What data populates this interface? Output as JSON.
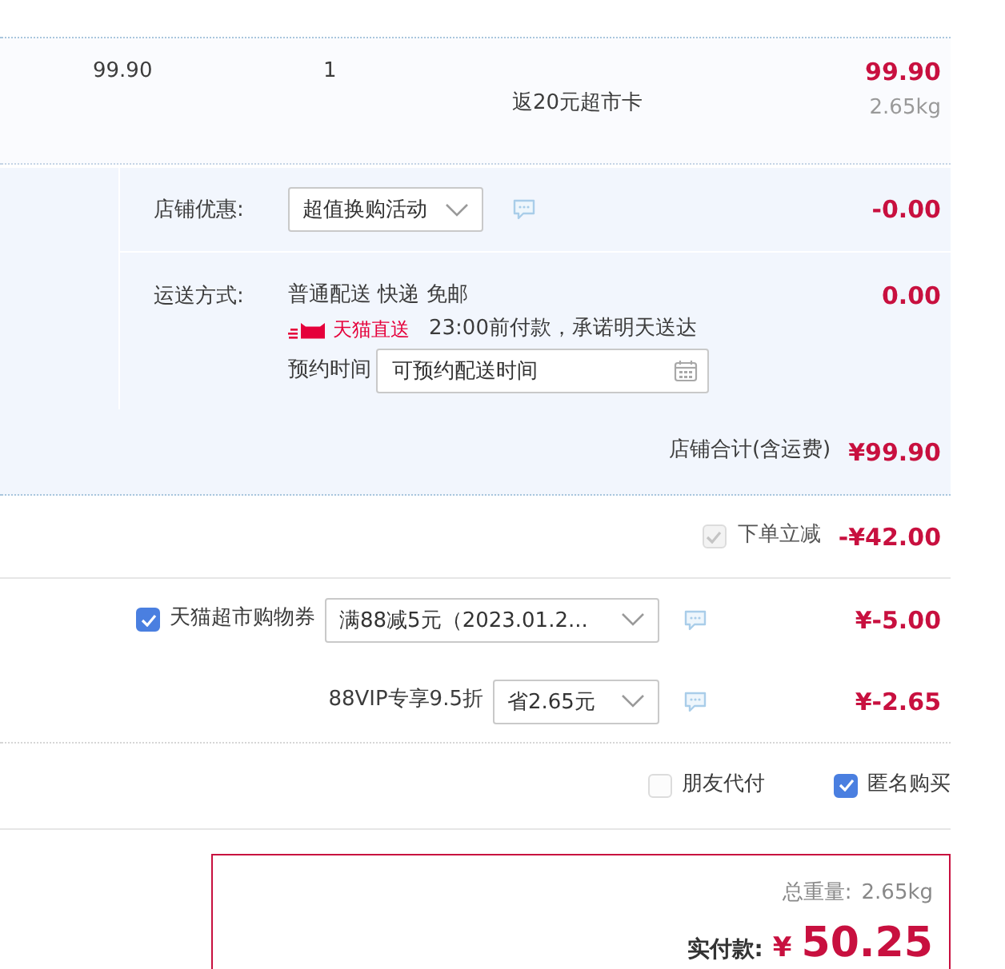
{
  "item_row": {
    "unit_price": "99.90",
    "quantity": "1",
    "promo_note": "返20元超市卡",
    "subtotal": "99.90",
    "weight": "2.65kg"
  },
  "shop_panel": {
    "discount": {
      "label": "店铺优惠:",
      "select": "超值换购活动",
      "amount": "-0.00"
    },
    "shipping": {
      "label": "运送方式:",
      "method": "普通配送 快递 免邮",
      "badge": "天猫直送",
      "promise": "23:00前付款，承诺明天送达",
      "appointment_label": "预约时间",
      "appointment_field": {
        "placeholder": "可预约配送时间"
      },
      "amount": "0.00"
    },
    "total_label": "店铺合计(含运费)",
    "total": "¥99.90"
  },
  "instant_discount": {
    "checked": true,
    "disabled": true,
    "label": "下单立减",
    "amount": "-¥42.00"
  },
  "coupons": [
    {
      "kind": "checkbox",
      "checked": true,
      "label": "天猫超市购物券",
      "select": "满88减5元（2023.01.2...",
      "amount": "¥-5.00"
    },
    {
      "kind": "plain",
      "label": "88VIP专享9.5折",
      "select": "省2.65元",
      "amount": "¥-2.65"
    }
  ],
  "options": [
    {
      "label": "朋友代付",
      "checked": false
    },
    {
      "label": "匿名购买",
      "checked": true
    }
  ],
  "summary": {
    "weight_label": "总重量:",
    "weight": "2.65kg",
    "pay_label": "实付款:",
    "currency": "¥",
    "pay": "50.25"
  }
}
